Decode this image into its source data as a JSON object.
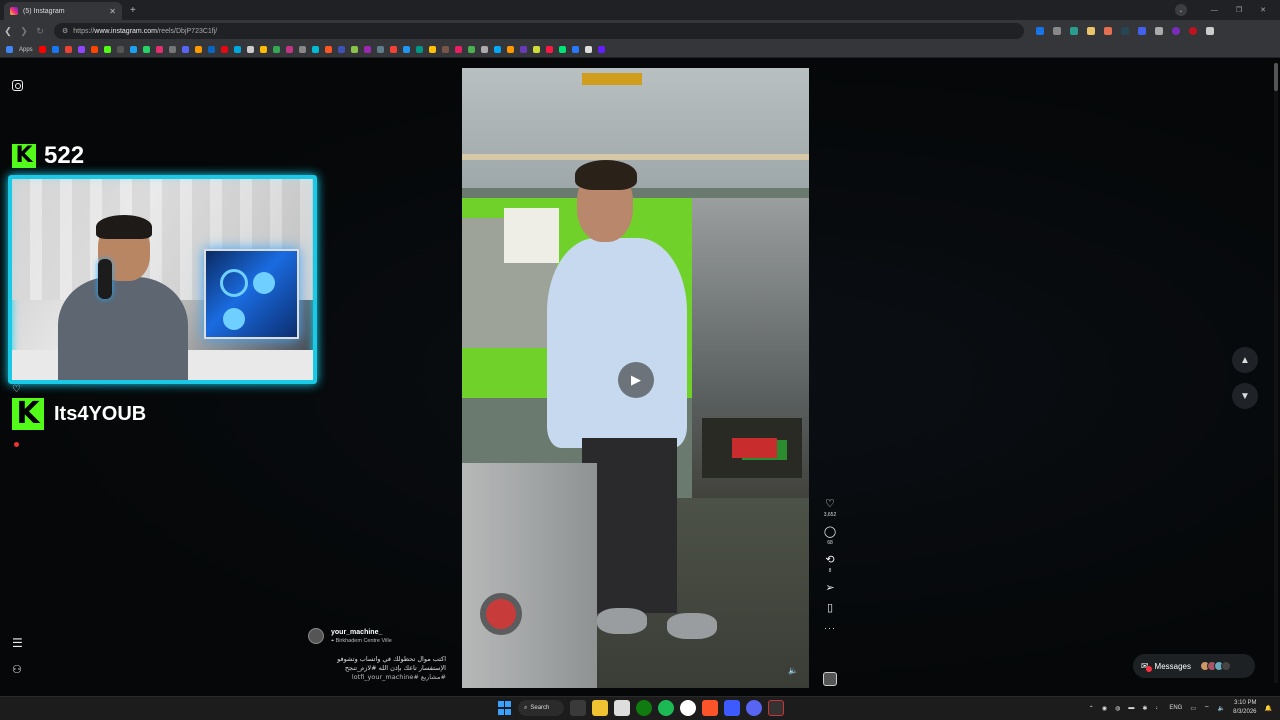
{
  "browser": {
    "tab_title": "(5) Instagram",
    "url_scheme": "https://",
    "url_host": "www.instagram.com",
    "url_path": "/reels/DbjP723C1fj/",
    "bookmarks_apps_label": "Apps"
  },
  "stream_overlay": {
    "kick_logo": "K",
    "follower_count": "522",
    "streamer_name": "Its4YOUB"
  },
  "reel": {
    "username": "your_machine_",
    "location": "Birkhadem Centre Ville",
    "caption_line1": "اكتب موال تحطولك في واتساب وتشوفو",
    "caption_line2": "الإستفسار تاعك بإذن الله #لازم_تنجح",
    "hashtags": "#مشاريع #lotfi_your_machine",
    "likes": "3,652",
    "comments": "68",
    "reposts": "8"
  },
  "messages": {
    "label": "Messages"
  },
  "taskbar": {
    "search_label": "Search",
    "lang": "ENG",
    "time": "3:10 PM",
    "date": "8/3/2026"
  },
  "icons": {
    "play": "▶",
    "heart": "♡",
    "comment": "◯",
    "repost": "⟲",
    "share": "➢",
    "save": "▯",
    "more": "···",
    "up": "▲",
    "down": "▼",
    "menu": "☰",
    "mute": "🔈"
  },
  "colors": {
    "kick_green": "#53fc18",
    "cam_border": "#19c9e6",
    "notification_red": "#ff3040"
  }
}
